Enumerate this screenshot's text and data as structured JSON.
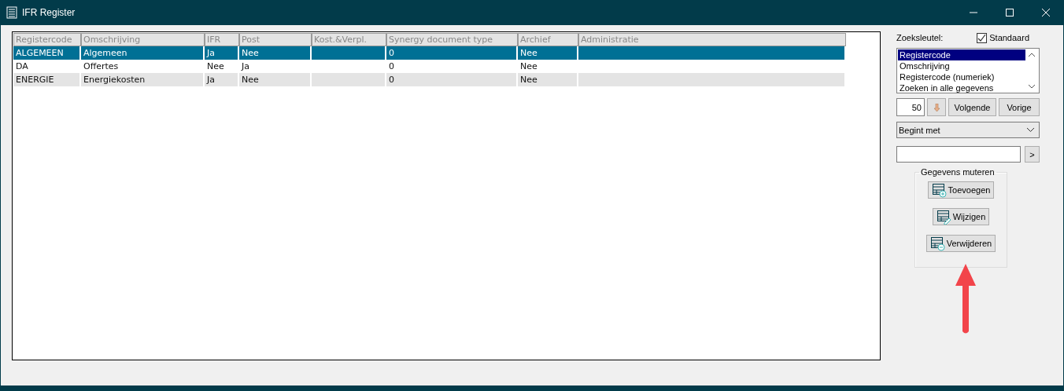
{
  "window": {
    "title": "IFR Register"
  },
  "table": {
    "columns": [
      "Registercode",
      "Omschrijving",
      "IFR",
      "Post",
      "Kost.&Verpl.",
      "Synergy document type",
      "Archief",
      "Administratie"
    ],
    "rows": [
      {
        "selected": true,
        "cells": [
          "ALGEMEEN",
          "Algemeen",
          "Ja",
          "Nee",
          "",
          "0",
          "Nee",
          ""
        ]
      },
      {
        "selected": false,
        "cells": [
          "DA",
          "Offertes",
          "Nee",
          "Ja",
          "",
          "0",
          "Nee",
          ""
        ]
      },
      {
        "selected": false,
        "cells": [
          "ENERGIE",
          "Energiekosten",
          "Ja",
          "Nee",
          "",
          "0",
          "Nee",
          ""
        ]
      }
    ]
  },
  "search": {
    "label": "Zoeksleutel:",
    "standard": {
      "label": "Standaard",
      "checked": true
    },
    "keys": [
      {
        "label": "Registercode",
        "selected": true
      },
      {
        "label": "Omschrijving",
        "selected": false
      },
      {
        "label": "Registercode (numeriek)",
        "selected": false
      },
      {
        "label": "Zoeken in alle gegevens",
        "selected": false
      }
    ],
    "count": "50",
    "next": "Volgende",
    "previous": "Vorige",
    "mode": "Begint met",
    "go": ">"
  },
  "mutate": {
    "title": "Gegevens muteren",
    "buttons": [
      {
        "kind": "add",
        "label": "Toevoegen"
      },
      {
        "kind": "edit",
        "label": "Wijzigen"
      },
      {
        "kind": "delete",
        "label": "Verwijderen"
      }
    ]
  }
}
